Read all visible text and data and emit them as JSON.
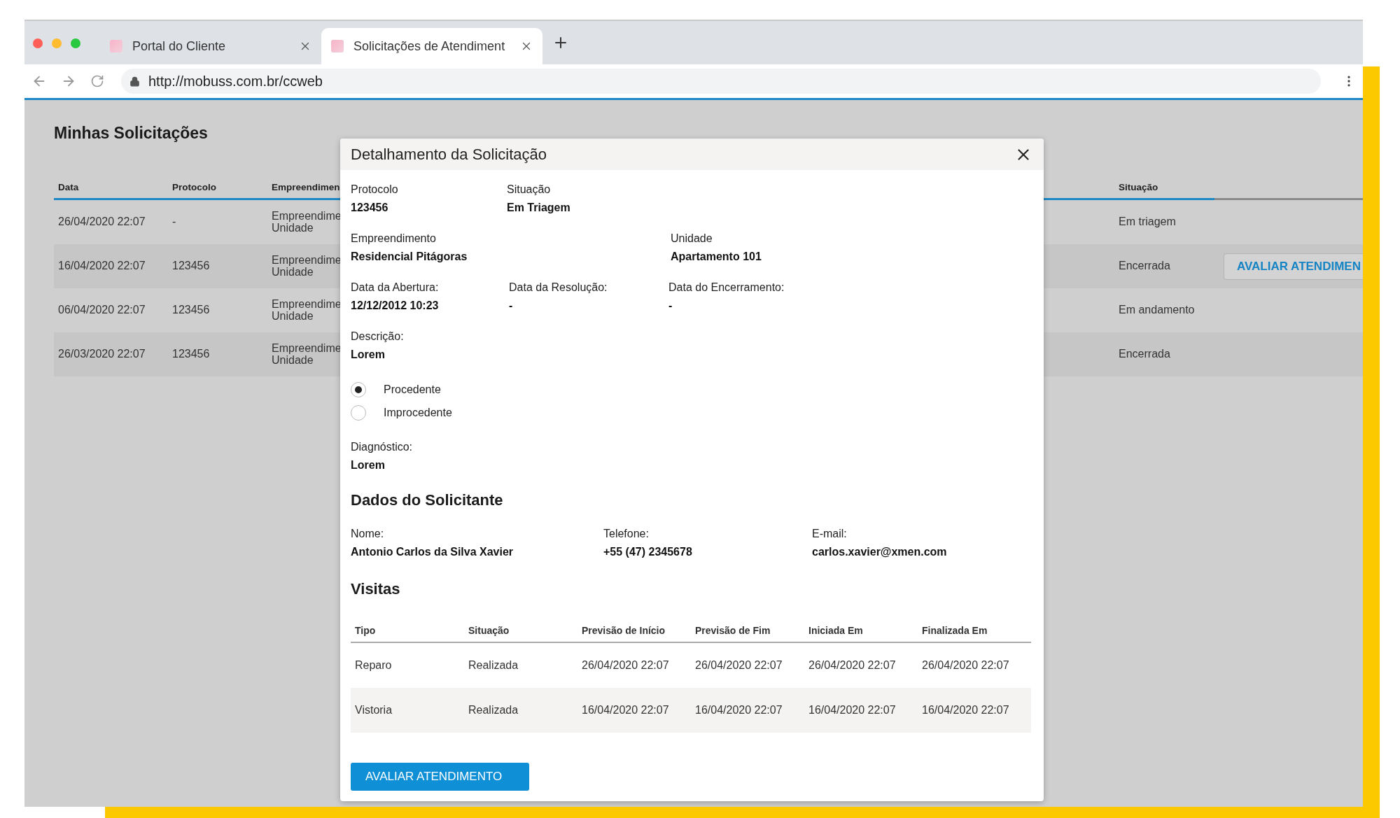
{
  "browser": {
    "tabs": [
      {
        "title": "Portal do Cliente",
        "selected": false
      },
      {
        "title": "Solicitações de Atendiment",
        "selected": true
      }
    ],
    "url": "http://mobuss.com.br/ccweb"
  },
  "page": {
    "title": "Minhas Solicitações",
    "table": {
      "columns": [
        "Data",
        "Protocolo",
        "Empreendimen",
        "Situação"
      ],
      "rows": [
        {
          "data": "26/04/2020 22:07",
          "protocolo": "-",
          "column_3": [
            "Empreendime",
            "Unidade"
          ],
          "situacao": "Em triagem"
        },
        {
          "data": "16/04/2020 22:07",
          "protocolo": "123456",
          "column_3": [
            "Empreendime",
            "Unidade"
          ],
          "situacao": "Encerrada",
          "action": "AVALIAR ATENDIMEN"
        },
        {
          "data": "06/04/2020 22:07",
          "protocolo": "123456",
          "column_3": [
            "Empreendime",
            "Unidade"
          ],
          "situacao": "Em andamento"
        },
        {
          "data": "26/03/2020 22:07",
          "protocolo": "123456",
          "column_3": [
            "Empreendime",
            "Unidade"
          ],
          "situacao": "Encerrada"
        }
      ]
    }
  },
  "modal": {
    "title": "Detalhamento da Solicitação",
    "field_rows": [
      [
        {
          "label": "Protocolo",
          "value": "123456"
        },
        {
          "label": "Situação",
          "value": "Em Triagem"
        }
      ],
      [
        {
          "label": "Empreendimento",
          "value": "Residencial Pitágoras"
        },
        {
          "label": "Unidade",
          "value": "Apartamento 101"
        }
      ],
      [
        {
          "label": "Data da Abertura:",
          "value": "12/12/2012 10:23"
        },
        {
          "label": "Data da Resolução:",
          "value": "-"
        },
        {
          "label": "Data do Encerramento:",
          "value": "-"
        }
      ],
      [
        {
          "label": "Descrição:",
          "value": "Lorem"
        }
      ]
    ],
    "options": [
      {
        "label": "Procedente",
        "selected": true
      },
      {
        "label": "Improcedente",
        "selected": false
      }
    ],
    "diagnostico": {
      "label": "Diagnóstico:",
      "value": "Lorem"
    },
    "solicitante": {
      "heading": "Dados do Solicitante",
      "fields": [
        {
          "label": "Nome:",
          "value": "Antonio Carlos da Silva Xavier"
        },
        {
          "label": "Telefone:",
          "value": "+55 (47) 2345678"
        },
        {
          "label": "E-mail:",
          "value": "carlos.xavier@xmen.com"
        }
      ]
    },
    "visitas": {
      "heading": "Visitas",
      "columns": [
        "Tipo",
        "Situação",
        "Previsão de Início",
        "Previsão de Fim",
        "Iniciada Em",
        "Finalizada Em"
      ],
      "rows": [
        [
          "Reparo",
          "Realizada",
          "26/04/2020 22:07",
          "26/04/2020 22:07",
          "26/04/2020 22:07",
          "26/04/2020 22:07"
        ],
        [
          "Vistoria",
          "Realizada",
          "16/04/2020 22:07",
          "16/04/2020 22:07",
          "16/04/2020 22:07",
          "16/04/2020 22:07"
        ]
      ]
    },
    "button": "AVALIAR ATENDIMENTO"
  }
}
